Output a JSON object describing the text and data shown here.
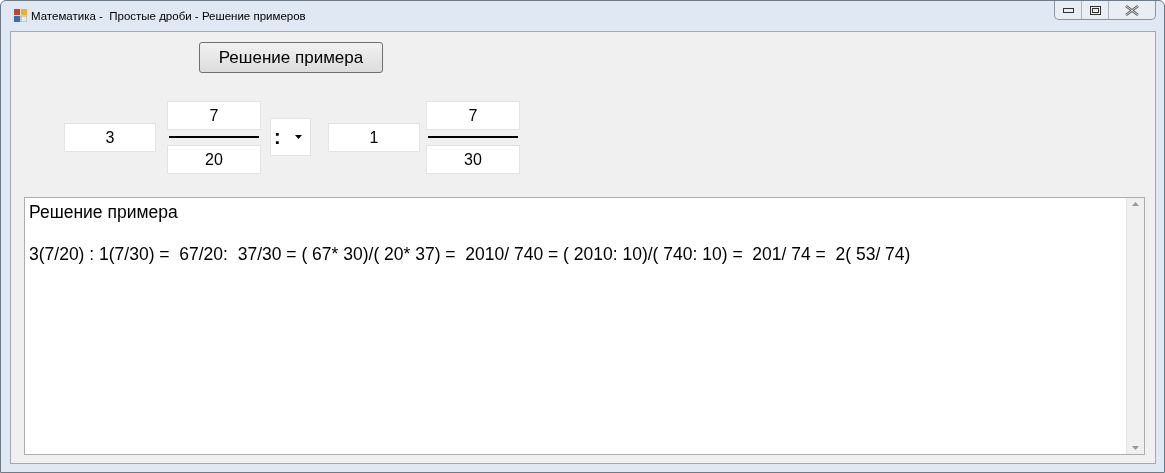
{
  "window": {
    "title": "Математика -  Простые дроби - Решение примеров"
  },
  "solve_button": "Решение примера",
  "first_number": {
    "whole": "3",
    "numerator": "7",
    "denominator": "20"
  },
  "operator": ":",
  "second_number": {
    "whole": "1",
    "numerator": "7",
    "denominator": "30"
  },
  "output": {
    "lines": [
      "Решение примера",
      "3(7/20) : 1(7/30) =  67/20:  37/30 = ( 67* 30)/( 20* 37) =  2010/ 740 = ( 2010: 10)/( 740: 10) =  201/ 74 =  2( 53/ 74)"
    ]
  }
}
